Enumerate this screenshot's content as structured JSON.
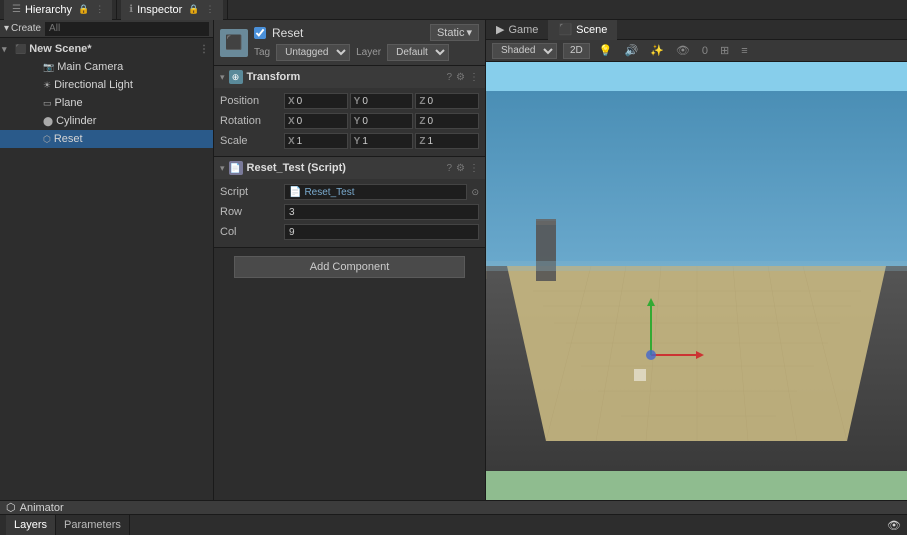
{
  "hierarchy": {
    "title": "Hierarchy",
    "scene": "New Scene*",
    "items": [
      {
        "label": "Main Camera",
        "indent": 2,
        "type": "camera"
      },
      {
        "label": "Directional Light",
        "indent": 2,
        "type": "light"
      },
      {
        "label": "Plane",
        "indent": 2,
        "type": "mesh"
      },
      {
        "label": "Cylinder",
        "indent": 2,
        "type": "mesh"
      },
      {
        "label": "Reset",
        "indent": 2,
        "type": "script",
        "selected": true
      }
    ]
  },
  "inspector": {
    "title": "Inspector",
    "object": {
      "name": "Reset",
      "active_checked": true,
      "static_label": "Static",
      "tag_label": "Tag",
      "tag_value": "Untagged",
      "layer_label": "Layer",
      "layer_value": "Default"
    },
    "transform": {
      "title": "Transform",
      "position": {
        "x": "0",
        "y": "0",
        "z": "0"
      },
      "rotation": {
        "x": "0",
        "y": "0",
        "z": "0"
      },
      "scale": {
        "x": "1",
        "y": "1",
        "z": "1"
      }
    },
    "script_component": {
      "title": "Reset_Test (Script)",
      "script_label": "Script",
      "script_value": "Reset_Test",
      "row_label": "Row",
      "row_value": "3",
      "col_label": "Col",
      "col_value": "9"
    },
    "add_component_label": "Add Component"
  },
  "viewport": {
    "tabs": [
      {
        "label": "Game",
        "icon": "▶",
        "active": false
      },
      {
        "label": "Scene",
        "icon": "⬛",
        "active": true
      }
    ],
    "toolbar": {
      "shading": "Shaded",
      "mode_2d": "2D"
    }
  },
  "animator": {
    "title": "Animator",
    "tabs": [
      {
        "label": "Layers",
        "active": true
      },
      {
        "label": "Parameters",
        "active": false
      }
    ]
  }
}
